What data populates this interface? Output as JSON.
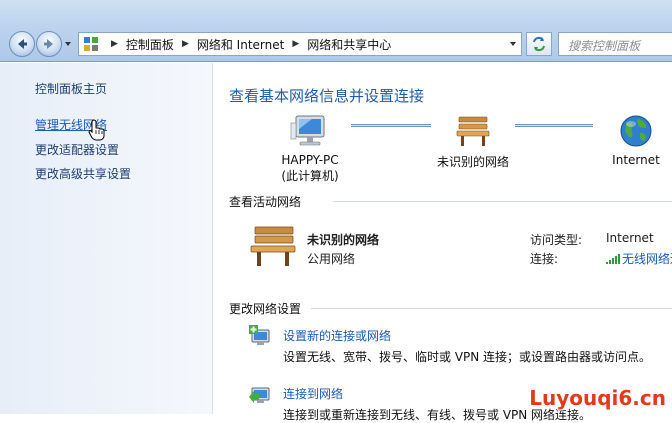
{
  "address_bar": {
    "crumbs": [
      "控制面板",
      "网络和 Internet",
      "网络和共享中心"
    ]
  },
  "search": {
    "placeholder": "搜索控制面板"
  },
  "sidebar": {
    "items": [
      {
        "label": "控制面板主页"
      },
      {
        "label": "管理无线网络"
      },
      {
        "label": "更改适配器设置"
      },
      {
        "label": "更改高级共享设置"
      }
    ]
  },
  "main": {
    "title": "查看基本网络信息并设置连接",
    "map": {
      "computer_name": "HAPPY-PC",
      "computer_sub": "(此计算机)",
      "network": "未识别的网络",
      "internet": "Internet"
    },
    "active_section": "查看活动网络",
    "active_network": {
      "name": "未识别的网络",
      "kind": "公用网络",
      "access_label": "访问类型:",
      "access_value": "Internet",
      "connection_label": "连接:",
      "connection_value": "无线网络连"
    },
    "change_section": "更改网络设置",
    "tasks": [
      {
        "link": "设置新的连接或网络",
        "desc": "设置无线、宽带、拨号、临时或 VPN 连接；或设置路由器或访问点。"
      },
      {
        "link": "连接到网络",
        "desc": "连接到或重新连接到无线、有线、拨号或 VPN 网络连接。"
      }
    ]
  },
  "watermark": "Luyouqi6.cn",
  "colors": {
    "link": "#1a5bb8",
    "title": "#1e5dab",
    "watermark": "#e23b1b"
  }
}
